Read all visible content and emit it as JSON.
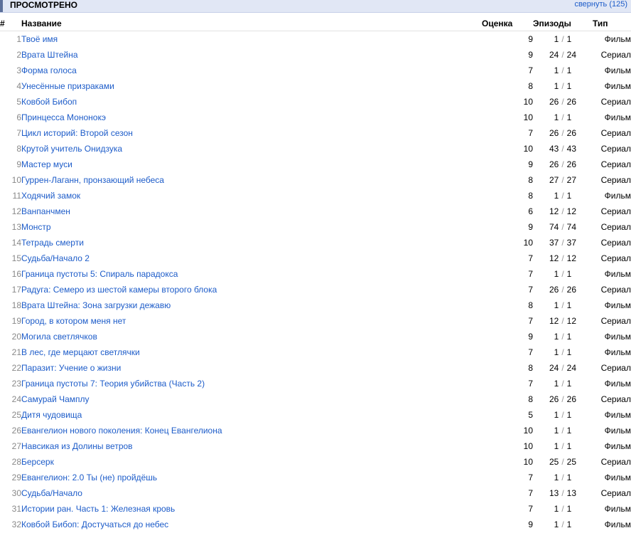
{
  "header": {
    "title": "ПРОСМОТРЕНО",
    "collapse_label": "свернуть",
    "count": "(125)"
  },
  "columns": {
    "num": "#",
    "name": "Название",
    "score": "Оценка",
    "episodes": "Эпизоды",
    "type": "Тип"
  },
  "rows": [
    {
      "n": "1",
      "name": "Твоё имя",
      "score": "9",
      "ep_done": "1",
      "ep_total": "1",
      "type": "Фильм"
    },
    {
      "n": "2",
      "name": "Врата Штейна",
      "score": "9",
      "ep_done": "24",
      "ep_total": "24",
      "type": "Сериал"
    },
    {
      "n": "3",
      "name": "Форма голоса",
      "score": "7",
      "ep_done": "1",
      "ep_total": "1",
      "type": "Фильм"
    },
    {
      "n": "4",
      "name": "Унесённые призраками",
      "score": "8",
      "ep_done": "1",
      "ep_total": "1",
      "type": "Фильм"
    },
    {
      "n": "5",
      "name": "Ковбой Бибоп",
      "score": "10",
      "ep_done": "26",
      "ep_total": "26",
      "type": "Сериал"
    },
    {
      "n": "6",
      "name": "Принцесса Мононокэ",
      "score": "10",
      "ep_done": "1",
      "ep_total": "1",
      "type": "Фильм"
    },
    {
      "n": "7",
      "name": "Цикл историй: Второй сезон",
      "score": "7",
      "ep_done": "26",
      "ep_total": "26",
      "type": "Сериал"
    },
    {
      "n": "8",
      "name": "Крутой учитель Онидзука",
      "score": "10",
      "ep_done": "43",
      "ep_total": "43",
      "type": "Сериал"
    },
    {
      "n": "9",
      "name": "Мастер муси",
      "score": "9",
      "ep_done": "26",
      "ep_total": "26",
      "type": "Сериал"
    },
    {
      "n": "10",
      "name": "Гуррен-Лаганн, пронзающий небеса",
      "score": "8",
      "ep_done": "27",
      "ep_total": "27",
      "type": "Сериал"
    },
    {
      "n": "11",
      "name": "Ходячий замок",
      "score": "8",
      "ep_done": "1",
      "ep_total": "1",
      "type": "Фильм"
    },
    {
      "n": "12",
      "name": "Ванпанчмен",
      "score": "6",
      "ep_done": "12",
      "ep_total": "12",
      "type": "Сериал"
    },
    {
      "n": "13",
      "name": "Монстр",
      "score": "9",
      "ep_done": "74",
      "ep_total": "74",
      "type": "Сериал"
    },
    {
      "n": "14",
      "name": "Тетрадь смерти",
      "score": "10",
      "ep_done": "37",
      "ep_total": "37",
      "type": "Сериал"
    },
    {
      "n": "15",
      "name": "Судьба/Начало 2",
      "score": "7",
      "ep_done": "12",
      "ep_total": "12",
      "type": "Сериал"
    },
    {
      "n": "16",
      "name": "Граница пустоты 5: Спираль парадокса",
      "score": "7",
      "ep_done": "1",
      "ep_total": "1",
      "type": "Фильм"
    },
    {
      "n": "17",
      "name": "Радуга: Семеро из шестой камеры второго блока",
      "score": "7",
      "ep_done": "26",
      "ep_total": "26",
      "type": "Сериал"
    },
    {
      "n": "18",
      "name": "Врата Штейна: Зона загрузки дежавю",
      "score": "8",
      "ep_done": "1",
      "ep_total": "1",
      "type": "Фильм"
    },
    {
      "n": "19",
      "name": "Город, в котором меня нет",
      "score": "7",
      "ep_done": "12",
      "ep_total": "12",
      "type": "Сериал"
    },
    {
      "n": "20",
      "name": "Могила светлячков",
      "score": "9",
      "ep_done": "1",
      "ep_total": "1",
      "type": "Фильм"
    },
    {
      "n": "21",
      "name": "В лес, где мерцают светлячки",
      "score": "7",
      "ep_done": "1",
      "ep_total": "1",
      "type": "Фильм"
    },
    {
      "n": "22",
      "name": "Паразит: Учение о жизни",
      "score": "8",
      "ep_done": "24",
      "ep_total": "24",
      "type": "Сериал"
    },
    {
      "n": "23",
      "name": "Граница пустоты 7: Теория убийства (Часть 2)",
      "score": "7",
      "ep_done": "1",
      "ep_total": "1",
      "type": "Фильм"
    },
    {
      "n": "24",
      "name": "Самурай Чамплу",
      "score": "8",
      "ep_done": "26",
      "ep_total": "26",
      "type": "Сериал"
    },
    {
      "n": "25",
      "name": "Дитя чудовища",
      "score": "5",
      "ep_done": "1",
      "ep_total": "1",
      "type": "Фильм"
    },
    {
      "n": "26",
      "name": "Евангелион нового поколения: Конец Евангелиона",
      "score": "10",
      "ep_done": "1",
      "ep_total": "1",
      "type": "Фильм"
    },
    {
      "n": "27",
      "name": "Навсикая из Долины ветров",
      "score": "10",
      "ep_done": "1",
      "ep_total": "1",
      "type": "Фильм"
    },
    {
      "n": "28",
      "name": "Берсерк",
      "score": "10",
      "ep_done": "25",
      "ep_total": "25",
      "type": "Сериал"
    },
    {
      "n": "29",
      "name": "Евангелион: 2.0 Ты (не) пройдёшь",
      "score": "7",
      "ep_done": "1",
      "ep_total": "1",
      "type": "Фильм"
    },
    {
      "n": "30",
      "name": "Судьба/Начало",
      "score": "7",
      "ep_done": "13",
      "ep_total": "13",
      "type": "Сериал"
    },
    {
      "n": "31",
      "name": "Истории ран. Часть 1: Железная кровь",
      "score": "7",
      "ep_done": "1",
      "ep_total": "1",
      "type": "Фильм"
    },
    {
      "n": "32",
      "name": "Ковбой Бибоп: Достучаться до небес",
      "score": "9",
      "ep_done": "1",
      "ep_total": "1",
      "type": "Фильм"
    }
  ]
}
